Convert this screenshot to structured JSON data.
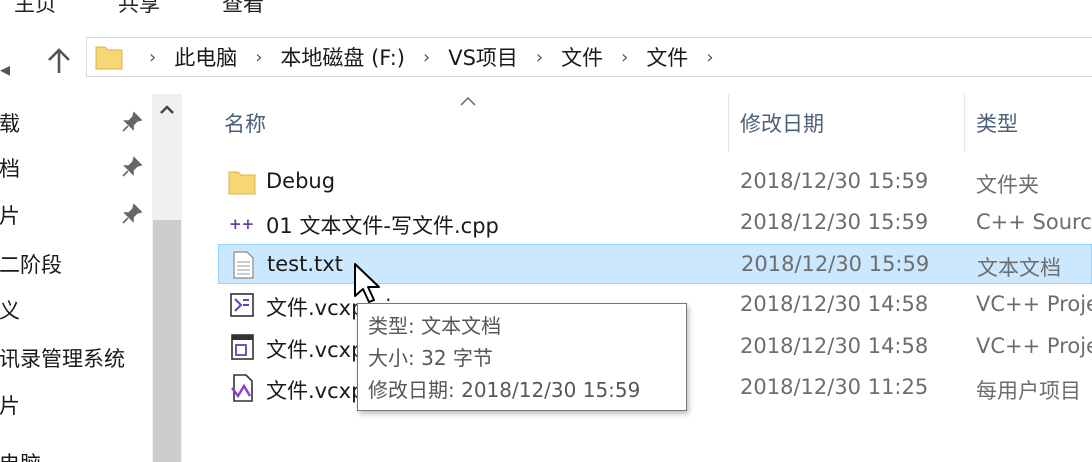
{
  "ribbon": {
    "tabs": [
      "主页",
      "共享",
      "查看"
    ]
  },
  "address": {
    "crumbs": [
      "此电脑",
      "本地磁盘 (F:)",
      "VS项目",
      "文件",
      "文件"
    ]
  },
  "nav_pane": {
    "items": [
      {
        "label": "下载",
        "pinned": true
      },
      {
        "label": "文档",
        "pinned": true
      },
      {
        "label": "图片",
        "pinned": true
      },
      {
        "label": "第二阶段",
        "pinned": false
      },
      {
        "label": "讲义",
        "pinned": false
      },
      {
        "label": "通讯录管理系统",
        "pinned": false
      },
      {
        "label": "图片",
        "pinned": false
      },
      {
        "label": "此电脑",
        "pinned": false
      }
    ]
  },
  "file_list": {
    "columns": {
      "name": "名称",
      "date": "修改日期",
      "type": "类型"
    },
    "rows": [
      {
        "icon": "folder-icon",
        "name": "Debug",
        "date": "2018/12/30 15:59",
        "type": "文件夹",
        "selected": false
      },
      {
        "icon": "cpp-file-icon",
        "name": "01 文本文件-写文件.cpp",
        "date": "2018/12/30 15:59",
        "type": "C++ Source",
        "selected": false
      },
      {
        "icon": "text-file-icon",
        "name": "test.txt",
        "date": "2018/12/30 15:59",
        "type": "文本文档",
        "selected": true
      },
      {
        "icon": "vcxproj-icon",
        "name": "文件.vcxproj",
        "date": "2018/12/30 14:58",
        "type": "VC++ Project",
        "selected": false
      },
      {
        "icon": "vcxproj-filters-icon",
        "name": "文件.vcxproj.filters",
        "date": "2018/12/30 14:58",
        "type": "VC++ Project",
        "selected": false
      },
      {
        "icon": "vcxproj-user-icon",
        "name": "文件.vcxproj.user",
        "date": "2018/12/30 11:25",
        "type": "每用户项目",
        "selected": false
      }
    ]
  },
  "tooltip": {
    "type_line": "类型: 文本文档",
    "size_line": "大小: 32 字节",
    "date_line": "修改日期: 2018/12/30 15:59"
  },
  "colors": {
    "selection_bg": "#cce8ff",
    "selection_border": "#99d1ff",
    "header_text": "#4c6079",
    "folder": "#f7d774"
  }
}
